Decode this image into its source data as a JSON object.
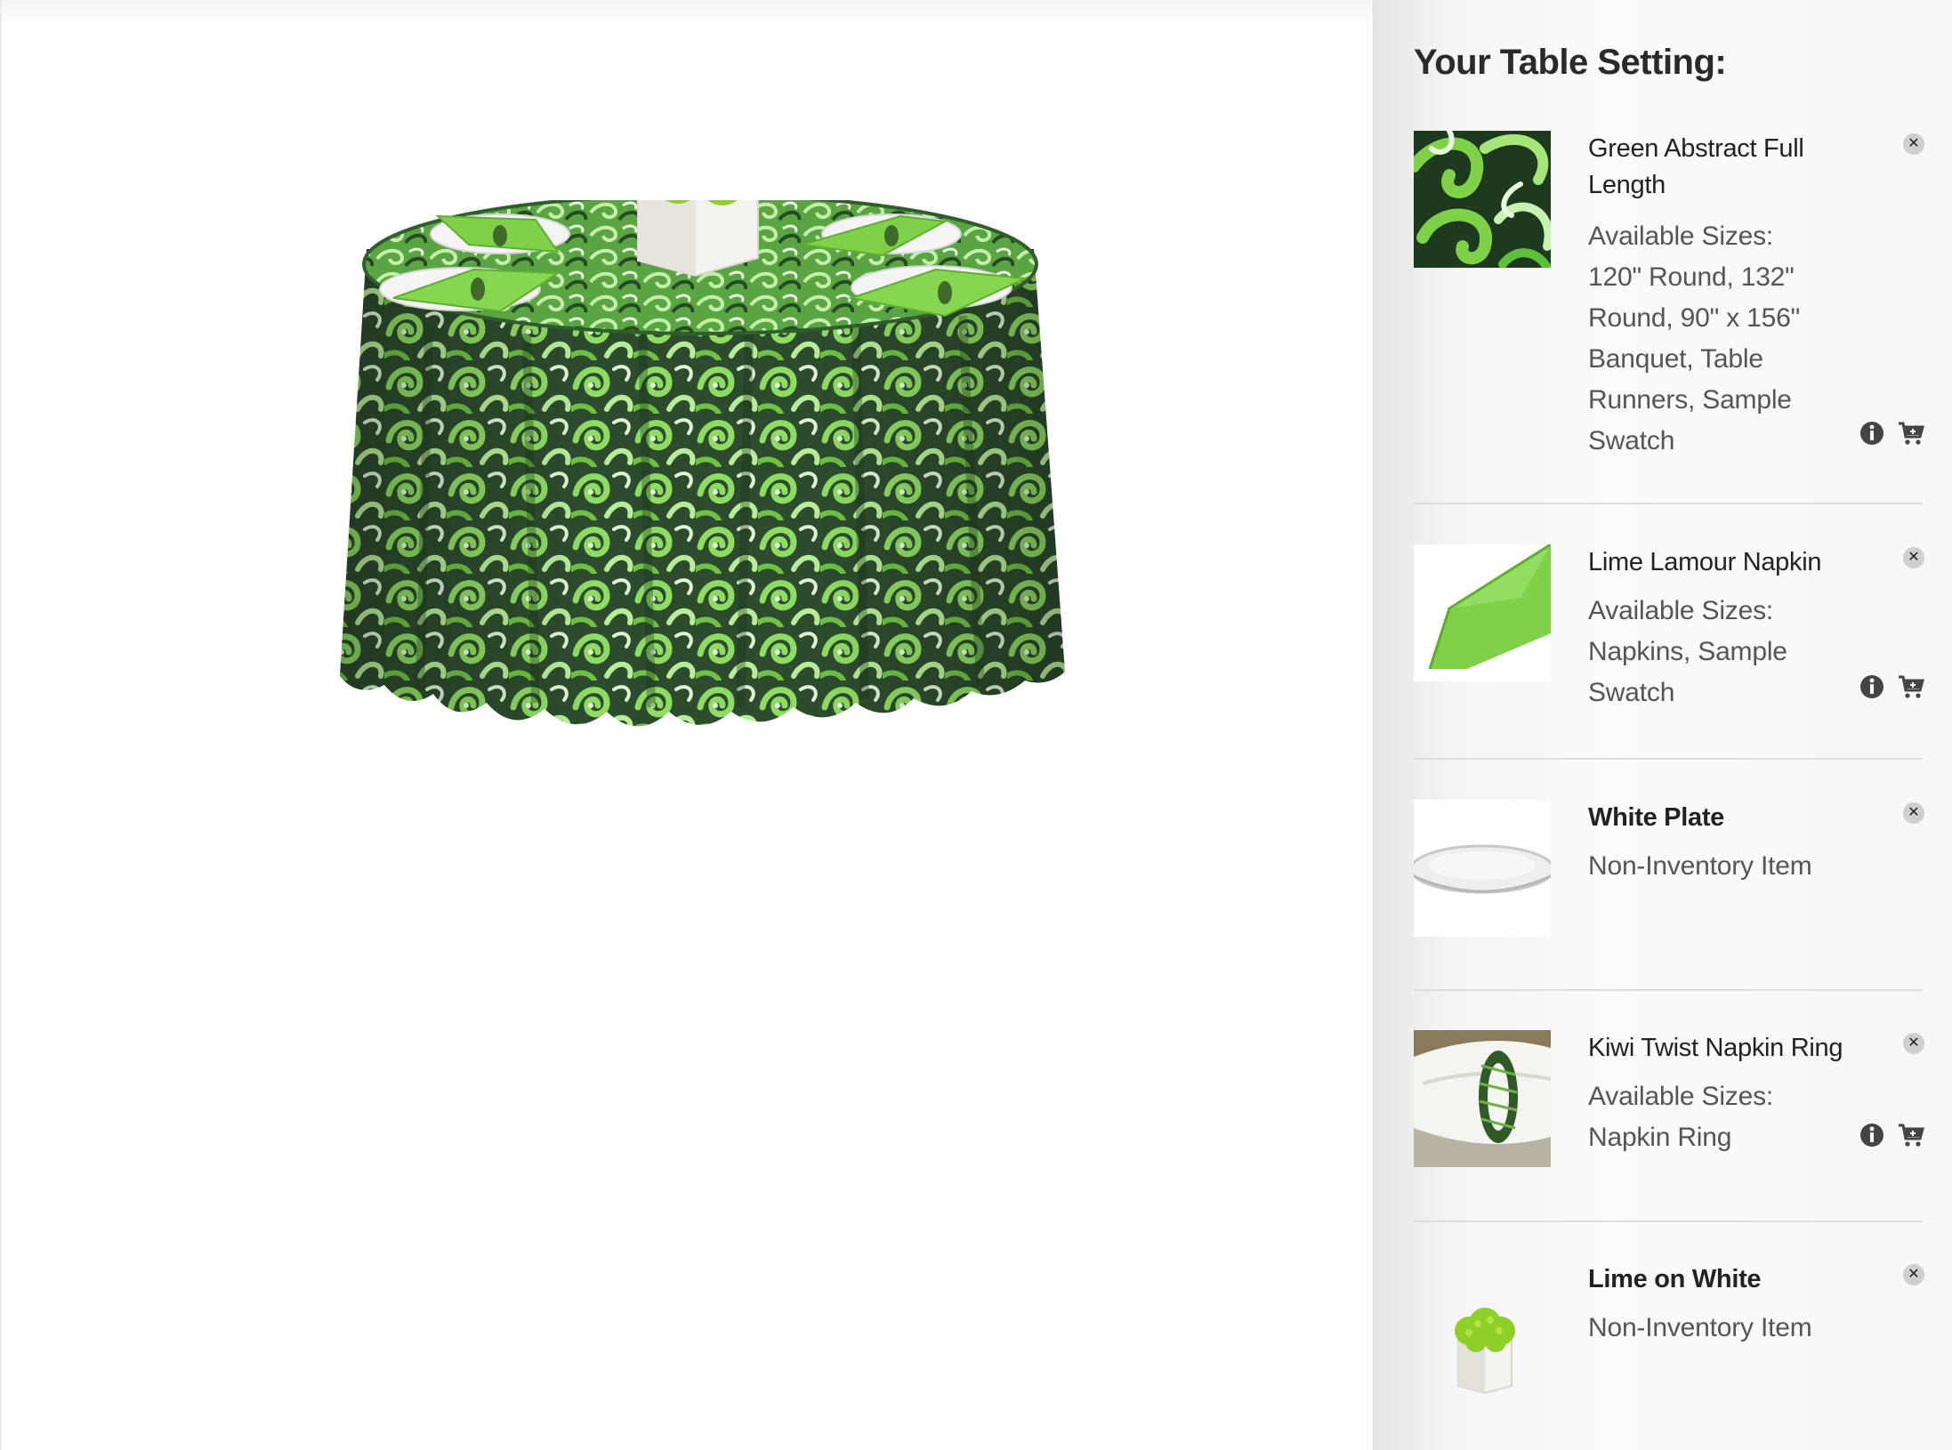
{
  "sidebar": {
    "title": "Your Table Setting:",
    "items": [
      {
        "name": "Green Abstract Full Length",
        "description": "Available Sizes: 120\" Round, 132\" Round, 90\" x 156\" Banquet, Table Runners, Sample Swatch",
        "thumb_icon": "green-abstract-fabric-swatch",
        "has_actions": true
      },
      {
        "name": "Lime Lamour Napkin",
        "description": "Available Sizes: Napkins, Sample Swatch",
        "thumb_icon": "lime-napkin",
        "has_actions": true
      },
      {
        "name": "White Plate",
        "description": "Non-Inventory Item",
        "thumb_icon": "white-plate",
        "has_actions": false
      },
      {
        "name": "Kiwi Twist Napkin Ring",
        "description": "Available Sizes: Napkin Ring",
        "thumb_icon": "kiwi-napkin-ring",
        "has_actions": true
      },
      {
        "name": "Lime on White",
        "description": "Non-Inventory Item",
        "thumb_icon": "lime-centerpiece",
        "has_actions": false
      }
    ]
  },
  "icons": {
    "remove": "close-icon",
    "info": "info-icon",
    "cart": "cart-icon"
  },
  "colors": {
    "lime": "#7fd14a",
    "dark_green": "#1f4a22",
    "sidebar_bg": "#f4f4f4",
    "title_text": "#2a2a2a"
  }
}
